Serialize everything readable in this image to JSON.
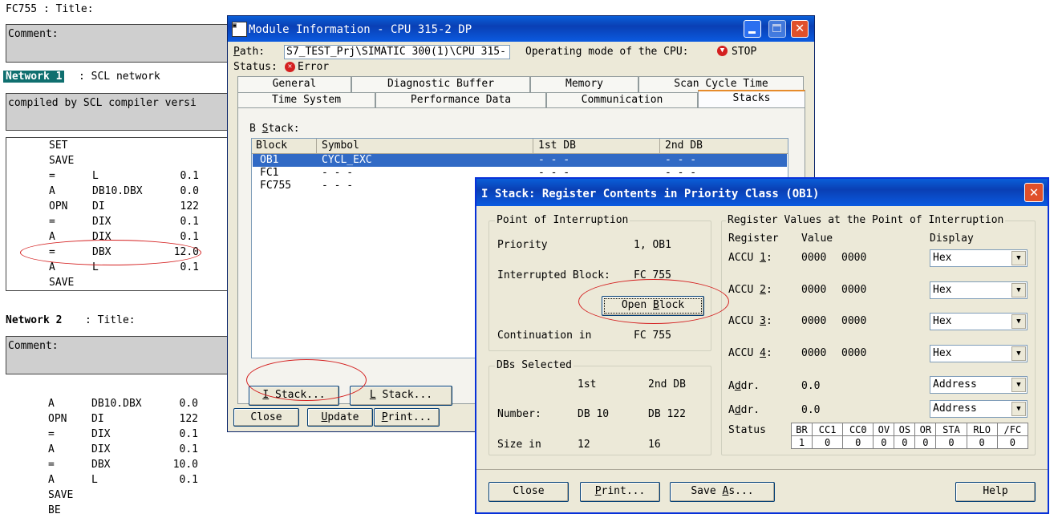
{
  "editor": {
    "fc_title": "FC755 : Title:",
    "comment1": "Comment:",
    "net1_label": "Network 1",
    "net1_title": ": SCL network",
    "net1_comment": "compiled by SCL compiler versi",
    "net1_code": [
      [
        "SET",
        "",
        ""
      ],
      [
        "SAVE",
        "",
        ""
      ],
      [
        "=",
        "L",
        "0.1"
      ],
      [
        "A",
        "DB10.DBX",
        "0.0"
      ],
      [
        "OPN",
        "DI",
        "122"
      ],
      [
        "=",
        "DIX",
        "0.1"
      ],
      [
        "A",
        "DIX",
        "0.1"
      ],
      [
        "=",
        "DBX",
        "12.0"
      ],
      [
        "A",
        "L",
        "0.1"
      ],
      [
        "SAVE",
        "",
        ""
      ]
    ],
    "net2_label": "Network 2",
    "net2_title": ": Title:",
    "comment2": "Comment:",
    "net2_code": [
      [
        "A",
        "DB10.DBX",
        "0.0"
      ],
      [
        "OPN",
        "DI",
        "122"
      ],
      [
        "=",
        "DIX",
        "0.1"
      ],
      [
        "A",
        "DIX",
        "0.1"
      ],
      [
        "=",
        "DBX",
        "10.0"
      ],
      [
        "A",
        "L",
        "0.1"
      ],
      [
        "SAVE",
        "",
        ""
      ],
      [
        "BE",
        "",
        ""
      ]
    ]
  },
  "module": {
    "title": "Module Information - CPU 315-2 DP",
    "path_label": "Path:",
    "path_value": "S7_TEST_Prj\\SIMATIC 300(1)\\CPU 315-",
    "opmode_label": "Operating mode of the  CPU:",
    "opmode_value": "STOP",
    "status_label": "Status:",
    "status_value": "Error",
    "tabs_row1": [
      "General",
      "Diagnostic Buffer",
      "Memory",
      "Scan Cycle Time"
    ],
    "tabs_row2": [
      "Time System",
      "Performance Data",
      "Communication",
      "Stacks"
    ],
    "bstack_label": "B Stack:",
    "columns": [
      "Block",
      "Symbol",
      "1st DB",
      "2nd DB"
    ],
    "rows": [
      [
        "OB1",
        "CYCL_EXC",
        "- - -",
        "- - -"
      ],
      [
        "FC1",
        "- - -",
        "- - -",
        "- - -"
      ],
      [
        "FC755",
        "- - -",
        "",
        ""
      ]
    ],
    "istack_btn": "I Stack...",
    "lstack_btn": "L Stack...",
    "close_btn": "Close",
    "update_btn": "Update",
    "print_btn": "Print..."
  },
  "istack": {
    "title": "I Stack: Register Contents in Priority Class (OB1)",
    "poi_group": "Point of Interruption",
    "priority_label": "Priority",
    "priority_value": "1, OB1",
    "intblock_label": "Interrupted Block:",
    "intblock_value": "FC 755",
    "open_block_btn": "Open Block",
    "cont_label": "Continuation in",
    "cont_value": "FC 755",
    "dbs_group": "DBs Selected",
    "col_1st": "1st",
    "col_2nd": "2nd DB",
    "number_label": "Number:",
    "number_1st": "DB 10",
    "number_2nd": "DB 122",
    "size_label": "Size in",
    "size_1st": "12",
    "size_2nd": "16",
    "reg_group": "Register Values at the Point of Interruption",
    "hdr_register": "Register",
    "hdr_value": "Value",
    "hdr_display": "Display",
    "registers": [
      {
        "name": "ACCU 1:",
        "v1": "0000",
        "v2": "0000",
        "display": "Hex"
      },
      {
        "name": "ACCU 2:",
        "v1": "0000",
        "v2": "0000",
        "display": "Hex"
      },
      {
        "name": "ACCU 3:",
        "v1": "0000",
        "v2": "0000",
        "display": "Hex"
      },
      {
        "name": "ACCU 4:",
        "v1": "0000",
        "v2": "0000",
        "display": "Hex"
      }
    ],
    "addr": [
      {
        "name": "Addr.",
        "value": "0.0",
        "display": "Address"
      },
      {
        "name": "Addr.",
        "value": "0.0",
        "display": "Address"
      }
    ],
    "status_label": "Status",
    "status_headers": [
      "BR",
      "CC1",
      "CC0",
      "OV",
      "OS",
      "OR",
      "STA",
      "RLO",
      "/FC"
    ],
    "status_values": [
      "1",
      "0",
      "0",
      "0",
      "0",
      "0",
      "0",
      "0",
      "0"
    ],
    "close_btn": "Close",
    "print_btn": "Print...",
    "saveas_btn": "Save As...",
    "help_btn": "Help"
  },
  "colors": {
    "highlight": "#0a246a",
    "annotation": "#d42020",
    "selection": "#316ac5"
  }
}
